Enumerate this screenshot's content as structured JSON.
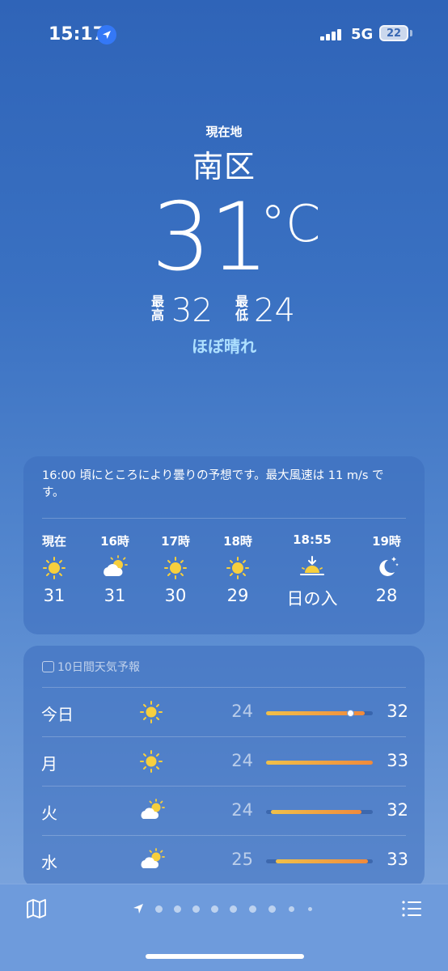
{
  "status": {
    "time": "15:17",
    "network": "5G",
    "battery": "22"
  },
  "hero": {
    "location_label": "現在地",
    "city": "南区",
    "temp": "31",
    "unit": "°C",
    "high_label": "最\n高",
    "high": "32",
    "low_label": "最\n低",
    "low": "24",
    "condition": "ほぼ晴れ"
  },
  "hourly": {
    "summary": "16:00 頃にところにより曇りの予想です。最大風速は 11 m/s です。",
    "items": [
      {
        "label": "現在",
        "icon": "sun-icon",
        "temp": "31"
      },
      {
        "label": "16時",
        "icon": "partly-cloudy-icon",
        "temp": "31"
      },
      {
        "label": "17時",
        "icon": "sun-icon",
        "temp": "30"
      },
      {
        "label": "18時",
        "icon": "sun-icon",
        "temp": "29"
      },
      {
        "label": "18:55",
        "icon": "sunset-icon",
        "temp": "日の入"
      },
      {
        "label": "19時",
        "icon": "moon-stars-icon",
        "temp": "28"
      }
    ]
  },
  "forecast": {
    "title": "10日間天気予報",
    "days": [
      {
        "day": "今日",
        "icon": "sun-icon",
        "low": "24",
        "high": "32"
      },
      {
        "day": "月",
        "icon": "sun-icon",
        "low": "24",
        "high": "33"
      },
      {
        "day": "火",
        "icon": "partly-cloudy-icon",
        "low": "24",
        "high": "32"
      },
      {
        "day": "水",
        "icon": "partly-cloudy-icon",
        "low": "25",
        "high": "33"
      }
    ]
  },
  "colors": {
    "accent_condition": "#aee0ff",
    "bar_start": "#f0c04a",
    "bar_end": "#f08a3c"
  }
}
